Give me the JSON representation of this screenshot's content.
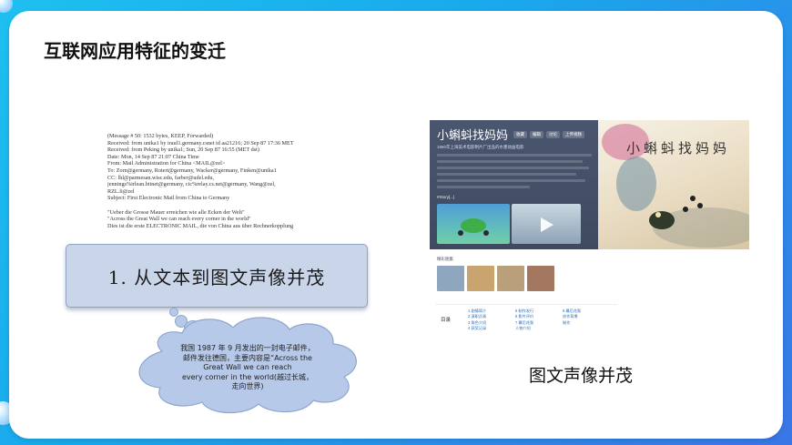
{
  "slide": {
    "title": "互联网应用特征的变迁",
    "email": {
      "lines": [
        "(Message # 50: 1532 bytes, KEEP, Forwarded)",
        "Received: from unika1 by iraul1.germany.csnet id aa21216; 20 Sep 87 17:36 MET",
        "Received: from Peking by unika1; Sun, 20 Sep 87 16:55 (MET dst)",
        "Date:    Mon, 14 Sep 87 21:07 China Time",
        "From:    Mail Administration for China <MAIL@zel>",
        "To:      Zorn@germany, Rotert@germany, Wacker@germany, Finken@unika1",
        "CC:      lhl@parmesan.wisc.edu, farber@udel.edu,",
        "         jennings%irlean.bitnet@germany, cic%relay.cs.net@germany, Wang@zel,",
        "         RZL.li@zel",
        "Subject:  First Electronic Mail from China to Germany",
        "",
        "\"Ueber die Grosse Mauer erreichen wie alle Ecken der Welt\"",
        "\"Across the Great Wall we can reach every corner in the world\"",
        "Dies ist die erste ELECTRONIC MAIL, die von China aus über Rechnerkopplung"
      ]
    },
    "callout_title": "1. 从文本到图文声像并茂",
    "cloud_note": "我国 1987 年 9 月发出的一封电子邮件，邮件发往德国，主要内容是“Across the Great Wall we can reach every corner in the world(越过长城，走向世界)",
    "cloud_note_lines": [
      "我国 1987 年 9 月发出的一封电子邮件，",
      "邮件发往德国，主要内容是“Across the",
      "Great Wall we can reach",
      "every corner in the world(越过长城，",
      "走向世界)"
    ],
    "web_screenshot": {
      "title": "小蝌蚪找妈妈",
      "actions": [
        "收藏",
        "编辑",
        "讨论",
        "上传视频"
      ],
      "subtitle": "1960年上海美术电影制片厂出品的水墨动画电影",
      "tag": "#Story[...]",
      "painting_title": "小蝌蚪找妈妈",
      "lower_tabs": "精彩图集",
      "toc_label": "目录",
      "toc_columns": [
        [
          "1  剧情简介",
          "2  演职员表",
          "3  角色介绍",
          "4  获奖记录"
        ],
        [
          "5  制作发行",
          "6  影片评价",
          "7  幕后花絮",
          "   人物介绍"
        ],
        [
          "8  幕后花絮",
          "   创作背景",
          "   制作"
        ]
      ]
    },
    "caption": "图文声像并茂"
  },
  "colors": {
    "background_accent": "#1ea9ec",
    "callout_fill": "#c9d6e9",
    "cloud_fill": "#b7c9e8"
  }
}
